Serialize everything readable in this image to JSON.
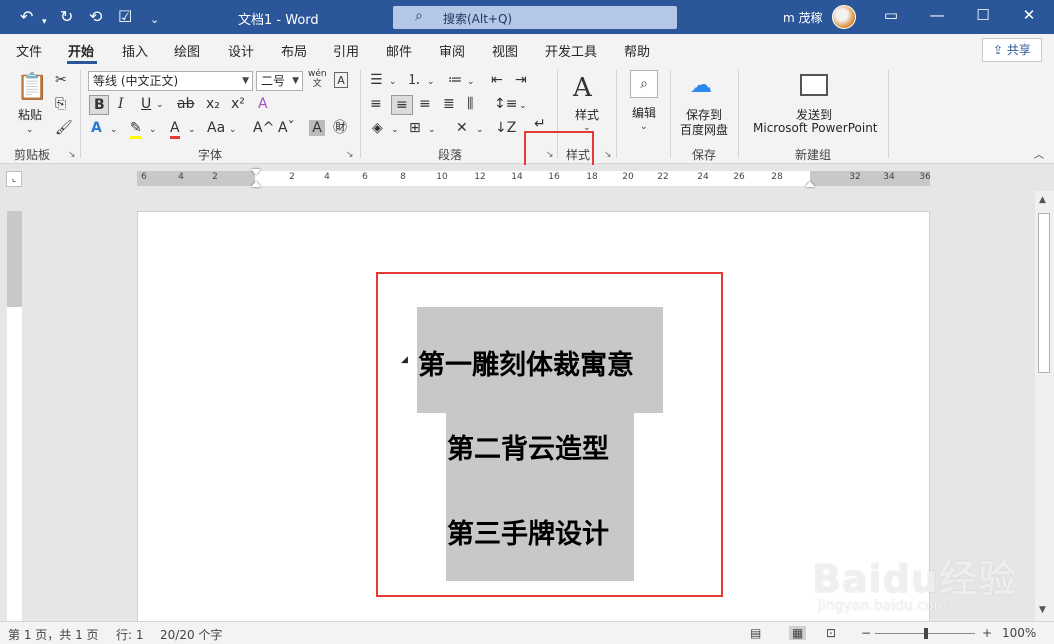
{
  "titlebar": {
    "title": "文档1  -  Word",
    "search_label": "搜索(Alt+Q)",
    "user_name": "m 茂稼"
  },
  "tabs": [
    {
      "label": "文件"
    },
    {
      "label": "开始"
    },
    {
      "label": "插入"
    },
    {
      "label": "绘图"
    },
    {
      "label": "设计"
    },
    {
      "label": "布局"
    },
    {
      "label": "引用"
    },
    {
      "label": "邮件"
    },
    {
      "label": "审阅"
    },
    {
      "label": "视图"
    },
    {
      "label": "开发工具"
    },
    {
      "label": "帮助"
    }
  ],
  "share_label": "共享",
  "ribbon": {
    "clipboard": {
      "paste_label": "粘贴",
      "group_label": "剪贴板"
    },
    "font": {
      "font_name": "等线 (中文正文)",
      "font_size": "二号",
      "group_label": "字体"
    },
    "paragraph": {
      "group_label": "段落"
    },
    "styles": {
      "styles_label": "样式",
      "group_label": "样式"
    },
    "editing": {
      "label": "编辑"
    },
    "save": {
      "label_line1": "保存到",
      "label_line2": "百度网盘",
      "group_label": "保存"
    },
    "newgroup": {
      "label_line1": "发送到",
      "label_line2": "Microsoft PowerPoint",
      "group_label": "新建组"
    }
  },
  "ruler_numbers": [
    "6",
    "4",
    "2",
    "2",
    "4",
    "6",
    "8",
    "10",
    "12",
    "14",
    "16",
    "18",
    "20",
    "22",
    "24",
    "26",
    "28",
    "32",
    "34",
    "36"
  ],
  "document": {
    "headings": [
      "第一雕刻体裁寓意",
      "第二背云造型",
      "第三手牌设计"
    ]
  },
  "statusbar": {
    "page_info": "第 1 页，共 1 页",
    "line_info": "行: 1",
    "word_count": "20/20 个字",
    "zoom": "100%"
  },
  "watermark": {
    "brand": "Baidu经验",
    "url": "jingyan.baidu.com"
  },
  "colors": {
    "titlebar": "#2b579a",
    "highlight_box": "#e53935",
    "heading_shading": "#c8c8c8"
  }
}
